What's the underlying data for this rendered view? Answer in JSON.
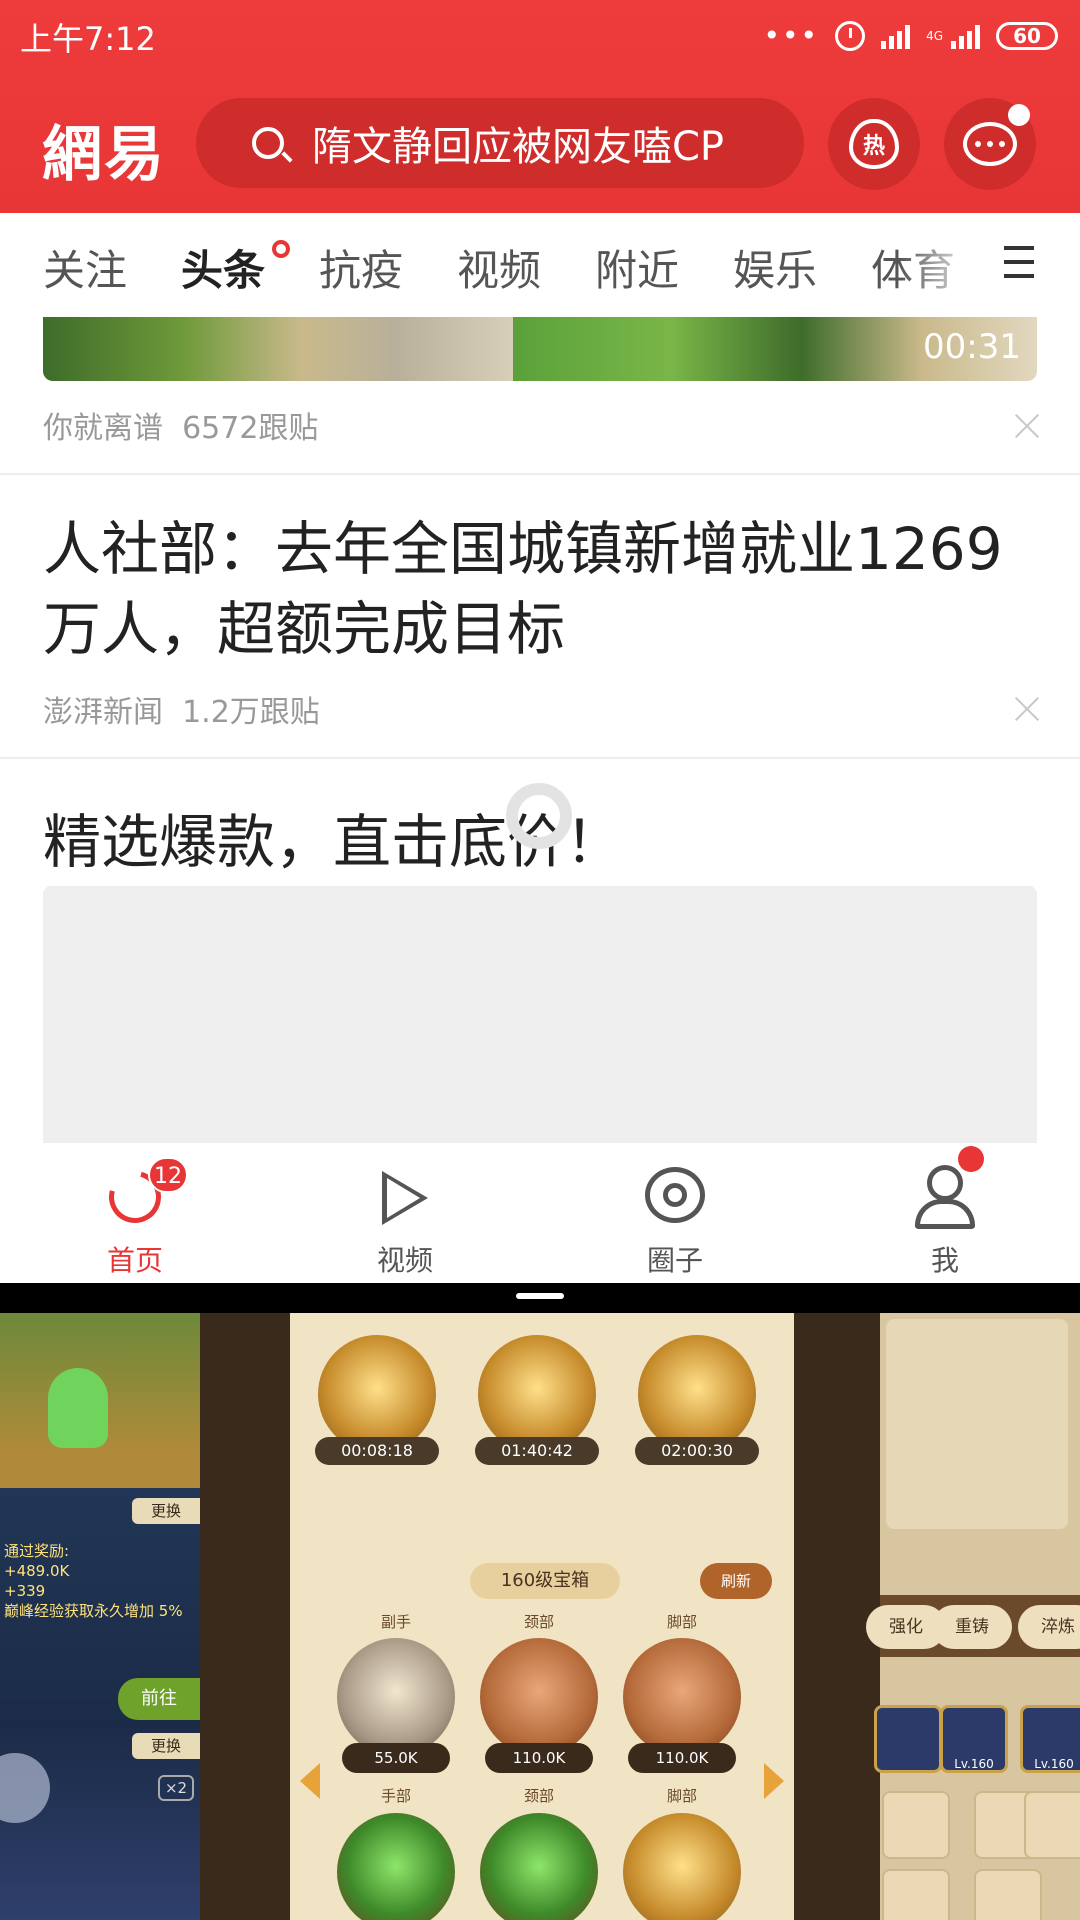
{
  "status_bar": {
    "time": "上午7:12",
    "network": "4G",
    "battery": "60"
  },
  "header": {
    "logo": "網易",
    "search_placeholder": "隋文静回应被网友嗑CP",
    "hot_label": "热"
  },
  "tabs": [
    {
      "label": "关注"
    },
    {
      "label": "头条",
      "active": true
    },
    {
      "label": "抗疫"
    },
    {
      "label": "视频"
    },
    {
      "label": "附近"
    },
    {
      "label": "娱乐"
    },
    {
      "label": "体育"
    }
  ],
  "feed": {
    "video_item": {
      "duration": "00:31",
      "source": "你就离谱",
      "comments": "6572跟贴"
    },
    "article": {
      "title": "人社部：去年全国城镇新增就业1269万人，超额完成目标",
      "source": "澎湃新闻",
      "comments": "1.2万跟贴"
    },
    "ad": {
      "title": "精选爆款，直击底价！"
    }
  },
  "bottom_nav": [
    {
      "label": "首页",
      "badge": "12",
      "active": true
    },
    {
      "label": "视频"
    },
    {
      "label": "圈子"
    },
    {
      "label": "我"
    }
  ],
  "game": {
    "left_panel": {
      "reward_title": "通过奖励:",
      "reward_1": "+489.0K",
      "reward_2": "+339",
      "reward_3": "巅峰经验获取永久增加 5%",
      "swap_label": "更换",
      "go_label": "前往",
      "multiplier": "×2"
    },
    "top_chests": [
      {
        "timer": "00:08:18"
      },
      {
        "timer": "01:40:42"
      },
      {
        "timer": "02:00:30"
      }
    ],
    "ribbon": "160级宝箱",
    "refresh_label": "刷新",
    "row1": [
      {
        "slot": "副手",
        "price": "55.0K"
      },
      {
        "slot": "颈部",
        "price": "110.0K"
      },
      {
        "slot": "脚部",
        "price": "110.0K"
      }
    ],
    "row2": [
      {
        "slot": "手部"
      },
      {
        "slot": "颈部"
      },
      {
        "slot": "脚部"
      }
    ],
    "right_panel": {
      "tabs": [
        "强化",
        "重铸",
        "淬炼"
      ],
      "item_level": "Lv.160"
    }
  }
}
